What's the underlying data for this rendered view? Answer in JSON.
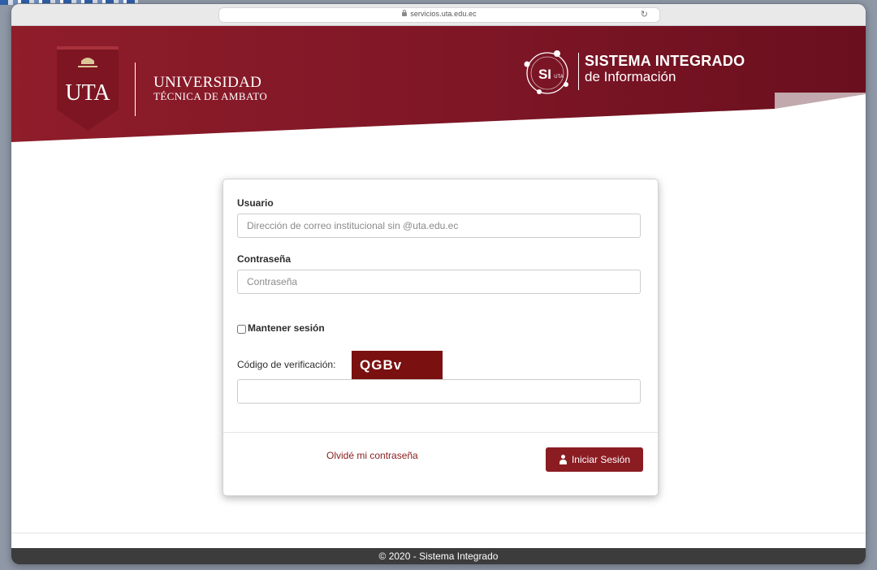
{
  "browser": {
    "url": "servicios.uta.edu.ec"
  },
  "header": {
    "logo_text": "UTA",
    "university_line1": "UNIVERSIDAD",
    "university_line2": "TÉCNICA DE AMBATO",
    "system_logo_main": "SI",
    "system_logo_small": "UTA",
    "system_title": "SISTEMA INTEGRADO",
    "system_subtitle": "de Información",
    "brand_color": "#8a1c22"
  },
  "login": {
    "user_label": "Usuario",
    "user_placeholder": "Dirección de correo institucional sin @uta.edu.ec",
    "user_value": "",
    "password_label": "Contraseña",
    "password_placeholder": "Contraseña",
    "password_value": "",
    "remember_label": "Mantener sesión",
    "verification_label": "Código de verificación:",
    "captcha_text": "QGBv",
    "verification_value": "",
    "forgot_link": "Olvidé mi contraseña",
    "login_button": "Iniciar Sesión"
  },
  "footer": {
    "text": "© 2020 - Sistema Integrado"
  }
}
